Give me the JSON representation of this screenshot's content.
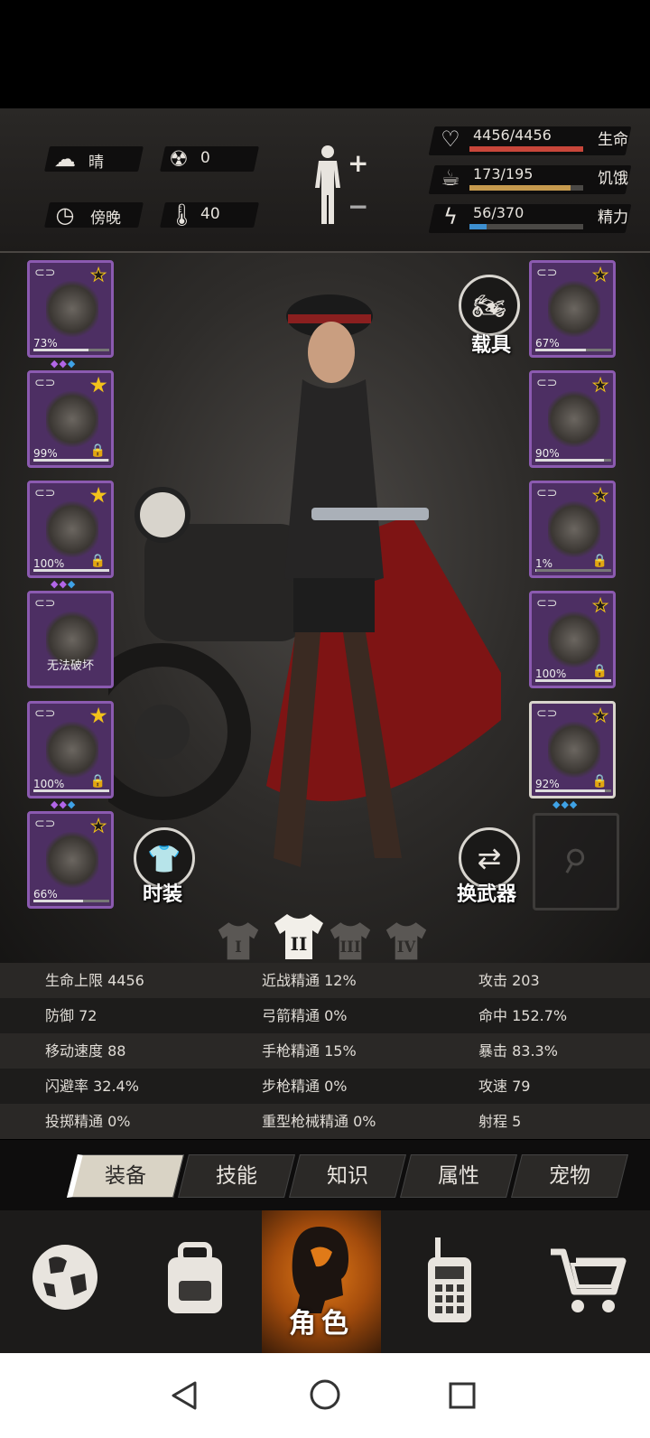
{
  "hud": {
    "weather": {
      "icon": "partly-cloudy-icon",
      "label": "晴"
    },
    "radiation": {
      "icon": "radiation-icon",
      "value": "0"
    },
    "time_of_day": {
      "icon": "clock-icon",
      "label": "傍晚"
    },
    "temperature": {
      "icon": "thermometer-icon",
      "value": "40"
    },
    "body_toggle": {
      "icon": "body-silhouette-icon",
      "plus": "+",
      "minus": "−"
    },
    "vitals": [
      {
        "key": "health",
        "icon": "heart-pulse-icon",
        "text": "4456/4456",
        "label": "生命",
        "fraction": 1.0,
        "color": "#c8463a"
      },
      {
        "key": "hunger",
        "icon": "stomach-icon",
        "text": "173/195",
        "label": "饥饿",
        "fraction": 0.887,
        "color": "#c69a4e"
      },
      {
        "key": "energy",
        "icon": "lightning-icon",
        "text": "56/370",
        "label": "精力",
        "fraction": 0.151,
        "color": "#3d8fd0"
      }
    ]
  },
  "equipment_left": [
    {
      "name": "helmet",
      "icon": "camo-helmet-icon",
      "pct": "73%",
      "durability": 0.73,
      "star": "★",
      "star_filled": false,
      "gems": "◆◆◆",
      "lock": false
    },
    {
      "name": "shirt",
      "icon": "jacket-icon",
      "pct": "99%",
      "durability": 0.99,
      "star": "★",
      "star_filled": true,
      "gems": "",
      "lock": true
    },
    {
      "name": "coat",
      "icon": "coat-icon",
      "pct": "100%",
      "durability": 1.0,
      "star": "★",
      "star_filled": true,
      "gems": "◆◆◆",
      "lock": true
    },
    {
      "name": "backpack",
      "icon": "backpack-icon",
      "center_label": "无法破坏",
      "gems": "",
      "lock": false
    },
    {
      "name": "pants",
      "icon": "pants-icon",
      "pct": "100%",
      "durability": 1.0,
      "star": "★",
      "star_filled": true,
      "gems": "◆◆◆",
      "lock": true
    },
    {
      "name": "boots",
      "icon": "boots-icon",
      "pct": "66%",
      "durability": 0.66,
      "star": "★",
      "star_filled": false,
      "gems": "",
      "lock": false
    }
  ],
  "equipment_right": [
    {
      "name": "goggles",
      "icon": "goggles-icon",
      "pct": "67%",
      "durability": 0.67,
      "star": "★",
      "star_filled": false,
      "lock": false
    },
    {
      "name": "gas-mask",
      "icon": "gas-mask-icon",
      "pct": "90%",
      "durability": 0.9,
      "star": "★",
      "star_filled": false,
      "lock": false
    },
    {
      "name": "vest",
      "icon": "tactical-vest-icon",
      "pct": "1%",
      "durability": 0.01,
      "star": "★",
      "star_filled": false,
      "lock": true
    },
    {
      "name": "bracer",
      "icon": "bracer-icon",
      "pct": "100%",
      "durability": 1.0,
      "star": "★",
      "star_filled": false,
      "lock": true
    },
    {
      "name": "revolver",
      "icon": "revolver-icon",
      "pct": "92%",
      "durability": 0.92,
      "star": "★",
      "star_filled": false,
      "lock": true,
      "gems": "◆◆◆",
      "selected": true
    }
  ],
  "scene": {
    "vehicle_label": "载具",
    "vehicle_icon": "motorcycle-icon",
    "fashion_label": "时装",
    "fashion_icon": "tshirt-icon",
    "switch_weapon_label": "换武器",
    "switch_weapon_icon": "swap-arrows-icon",
    "outfit_slots": [
      "I",
      "II",
      "III",
      "IV"
    ],
    "outfit_active": 1
  },
  "stats": [
    [
      "生命上限 4456",
      "近战精通 12%",
      "攻击 203"
    ],
    [
      "防御 72",
      "弓箭精通 0%",
      "命中 152.7%"
    ],
    [
      "移动速度 88",
      "手枪精通 15%",
      "暴击 83.3%"
    ],
    [
      "闪避率 32.4%",
      "步枪精通 0%",
      "攻速 79"
    ],
    [
      "投掷精通 0%",
      "重型枪械精通 0%",
      "射程 5"
    ]
  ],
  "tabs": [
    "装备",
    "技能",
    "知识",
    "属性",
    "宠物"
  ],
  "active_tab": 0,
  "nav": [
    {
      "icon": "globe-icon"
    },
    {
      "icon": "backpack-icon"
    },
    {
      "icon": "character-head-icon",
      "label": "角色",
      "active": true
    },
    {
      "icon": "walkie-talkie-icon"
    },
    {
      "icon": "shopping-cart-icon"
    }
  ],
  "system_nav": [
    "back-icon",
    "home-icon",
    "recents-icon"
  ]
}
